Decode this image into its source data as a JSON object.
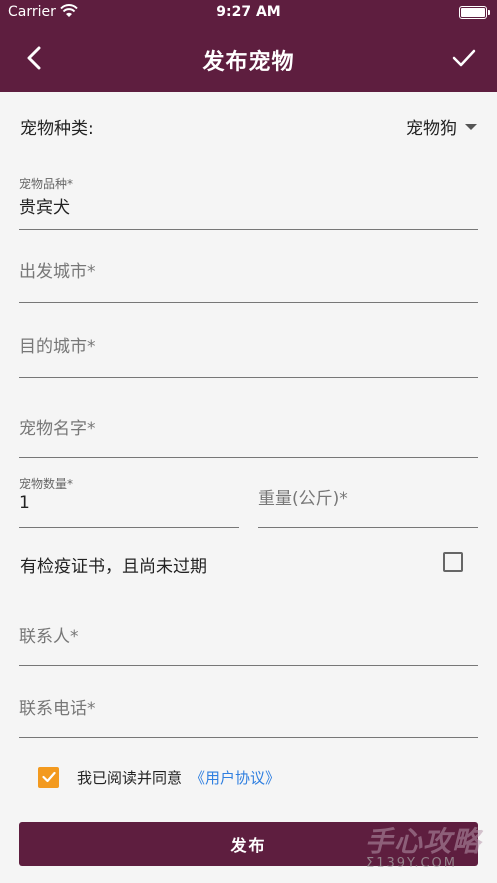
{
  "status_bar": {
    "carrier": "Carrier",
    "time": "9:27 AM"
  },
  "header": {
    "title": "发布宠物"
  },
  "pet_type": {
    "label": "宠物种类:",
    "selected": "宠物狗"
  },
  "breed": {
    "label": "宠物品种*",
    "value": "贵宾犬"
  },
  "departure_city": {
    "placeholder": "出发城市*"
  },
  "destination_city": {
    "placeholder": "目的城市*"
  },
  "pet_name": {
    "placeholder": "宠物名字*"
  },
  "quantity": {
    "label": "宠物数量*",
    "value": "1"
  },
  "weight": {
    "placeholder": "重量(公斤)*"
  },
  "quarantine": {
    "label": "有检疫证书，且尚未过期",
    "checked": false
  },
  "contact": {
    "placeholder": "联系人*"
  },
  "phone": {
    "placeholder": "联系电话*"
  },
  "agreement": {
    "text": "我已阅读并同意",
    "link": "《用户协议》",
    "checked": true
  },
  "submit_label": "发布",
  "watermark": {
    "main": "手心攻略",
    "sub": "Σ139Y.COM"
  },
  "colors": {
    "primary": "#5e1e3f",
    "checkbox": "#f39a1f",
    "link": "#2f7fe0"
  }
}
